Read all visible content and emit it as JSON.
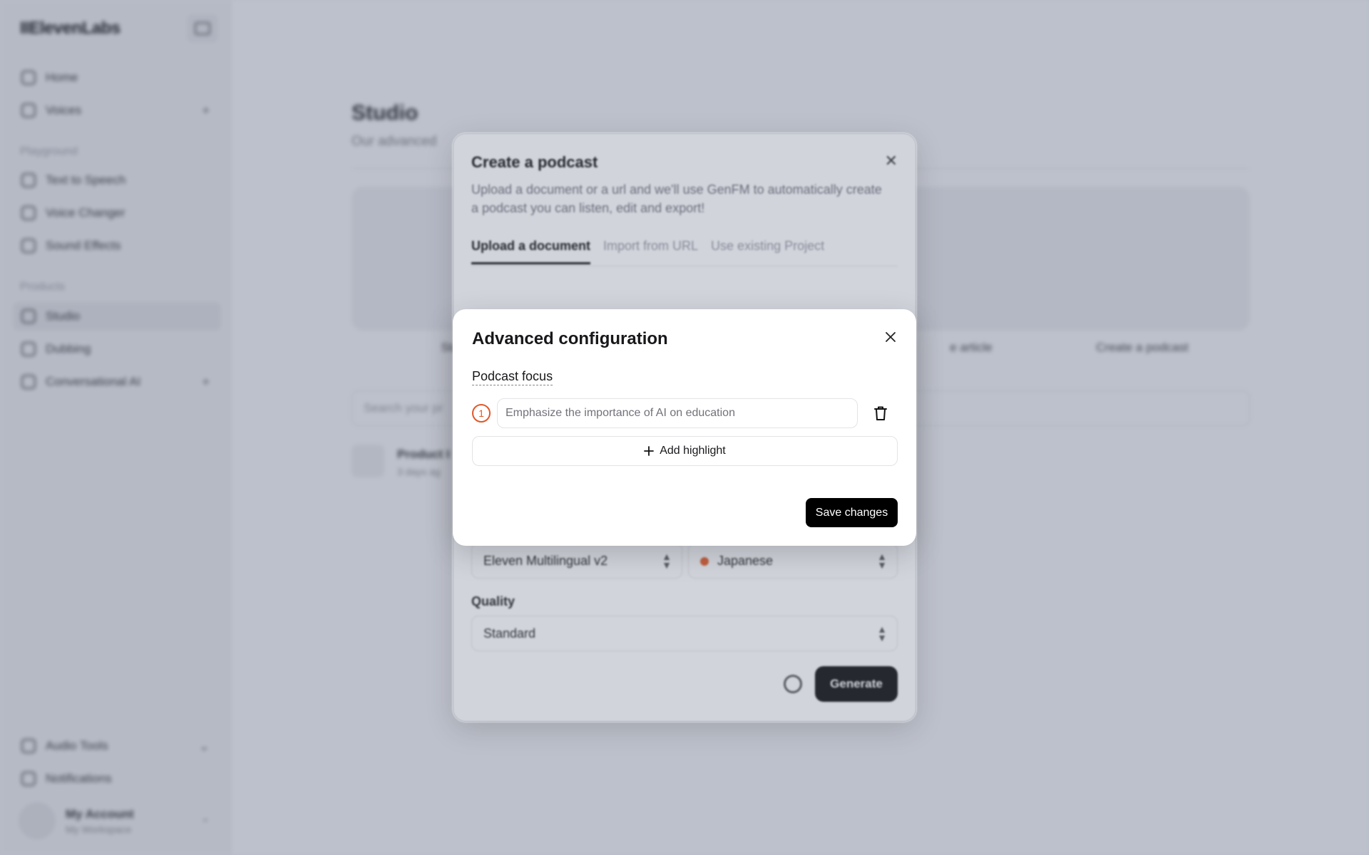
{
  "sidebar": {
    "logo": "IIElevenLabs",
    "nav_top": [
      {
        "label": "Home"
      },
      {
        "label": "Voices"
      }
    ],
    "playground_label": "Playground",
    "playground": [
      {
        "label": "Text to Speech"
      },
      {
        "label": "Voice Changer"
      },
      {
        "label": "Sound Effects"
      }
    ],
    "products_label": "Products",
    "products": [
      {
        "label": "Studio"
      },
      {
        "label": "Dubbing"
      },
      {
        "label": "Conversational AI"
      }
    ],
    "bottom": [
      {
        "label": "Audio Tools"
      },
      {
        "label": "Notifications"
      }
    ],
    "account": {
      "name": "My Account",
      "workspace": "My Workspace"
    }
  },
  "main": {
    "title": "Studio",
    "subtitle": "Our advanced",
    "cards": [
      {
        "label": "Start fr"
      },
      {
        "label": "e article"
      },
      {
        "label": "Create a podcast"
      }
    ],
    "search_placeholder": "Search your pr",
    "project": {
      "name": "Product I",
      "date": "3 days ag"
    }
  },
  "podcast_modal": {
    "title": "Create a podcast",
    "description": "Upload a document or a url and we'll use GenFM to automatically create a podcast you can listen, edit and export!",
    "tabs": [
      {
        "label": "Upload a document"
      },
      {
        "label": "Import from URL"
      },
      {
        "label": "Use existing Project"
      }
    ],
    "model": "Eleven Multilingual v2",
    "language": "Japanese",
    "quality_label": "Quality",
    "quality_value": "Standard",
    "generate_label": "Generate"
  },
  "advanced_config": {
    "title": "Advanced configuration",
    "focus_label": "Podcast focus",
    "highlights": [
      {
        "number": "1",
        "placeholder": "Emphasize the importance of AI on education",
        "value": ""
      }
    ],
    "add_highlight_label": "Add highlight",
    "save_label": "Save changes"
  },
  "colors": {
    "accent_orange": "#e0592a",
    "primary_button": "#000000",
    "overlay": "#5a647d"
  },
  "icons": {
    "close": "close-icon",
    "trash": "trash-icon",
    "plus": "plus-icon"
  }
}
